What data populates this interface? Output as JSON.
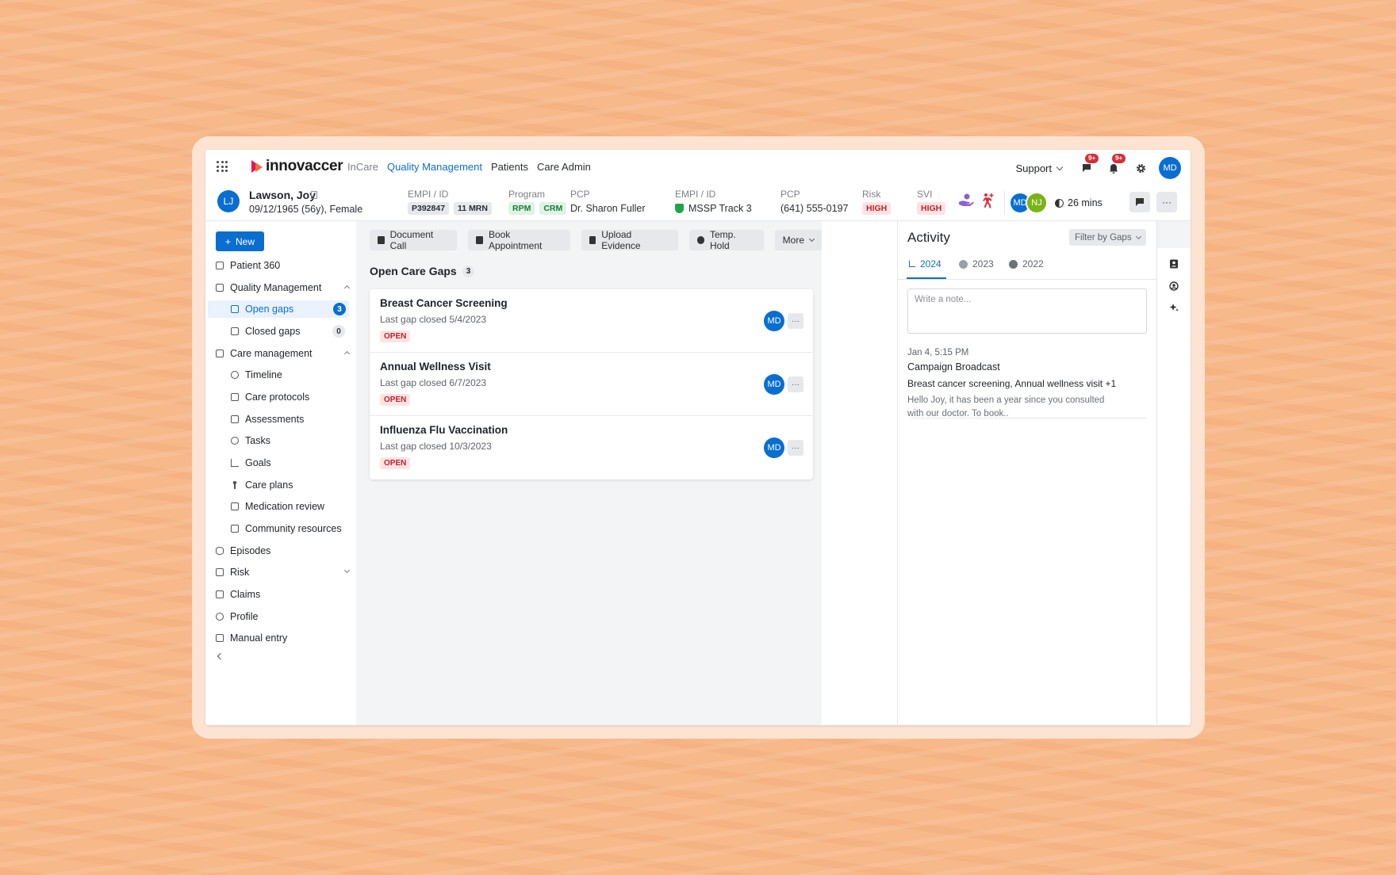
{
  "topnav": {
    "logo": "innovaccer",
    "links": [
      {
        "label": "InCare",
        "state": "muted"
      },
      {
        "label": "Quality Management",
        "state": "active"
      },
      {
        "label": "Patients",
        "state": "normal"
      },
      {
        "label": "Care Admin",
        "state": "normal"
      }
    ],
    "support_label": "Support",
    "messages_badge": "9+",
    "notifications_badge": "9+",
    "user_initials": "MD"
  },
  "patient": {
    "initials": "LJ",
    "name": "Lawson, Joy",
    "dob_line": "09/12/1965 (56y), Female",
    "empi_label": "EMPI / ID",
    "empi_ids": [
      "P392847",
      "11 MRN"
    ],
    "program_label": "Program",
    "programs": [
      "RPM",
      "CRM"
    ],
    "pcp_label": "PCP",
    "pcp_name": "Dr. Sharon Fuller",
    "empi2_label": "EMPI / ID",
    "plan": "MSSP Track 3",
    "pcp2_label": "PCP",
    "phone": "(641) 555-0197",
    "risk_label": "Risk",
    "risk_value": "HIGH",
    "svi_label": "SVI",
    "svi_value": "HIGH",
    "care_team": [
      "MD",
      "NJ"
    ],
    "timer": "26 mins",
    "more_label": "···"
  },
  "sidebar": {
    "new_label": "New",
    "items": [
      {
        "label": "Patient 360",
        "level": 0
      },
      {
        "label": "Quality Management",
        "level": 0,
        "expanded": true
      },
      {
        "label": "Open gaps",
        "level": 1,
        "active": true,
        "count": "3"
      },
      {
        "label": "Closed gaps",
        "level": 1,
        "count": "0"
      },
      {
        "label": "Care management",
        "level": 0,
        "expanded": true
      },
      {
        "label": "Timeline",
        "level": 1
      },
      {
        "label": "Care protocols",
        "level": 1
      },
      {
        "label": "Assessments",
        "level": 1
      },
      {
        "label": "Tasks",
        "level": 1
      },
      {
        "label": "Goals",
        "level": 1
      },
      {
        "label": "Care plans",
        "level": 1
      },
      {
        "label": "Medication review",
        "level": 1
      },
      {
        "label": "Community resources",
        "level": 1
      },
      {
        "label": "Episodes",
        "level": 0
      },
      {
        "label": "Risk",
        "level": 0,
        "expanded": false
      },
      {
        "label": "Claims",
        "level": 0
      },
      {
        "label": "Profile",
        "level": 0
      },
      {
        "label": "Manual entry",
        "level": 0
      }
    ]
  },
  "toolbar": {
    "buttons": [
      "Document Call",
      "Book Appointment",
      "Upload Evidence",
      "Temp. Hold",
      "More"
    ]
  },
  "gaps": {
    "title": "Open Care Gaps",
    "count": "3",
    "rows": [
      {
        "title": "Breast Cancer Screening",
        "subtitle": "Last gap closed 5/4/2023",
        "status": "OPEN",
        "assignee": "MD",
        "menu": "···"
      },
      {
        "title": "Annual Wellness Visit",
        "subtitle": "Last gap closed 6/7/2023",
        "status": "OPEN",
        "assignee": "MD",
        "menu": "···"
      },
      {
        "title": "Influenza Flu Vaccination",
        "subtitle": "Last gap closed 10/3/2023",
        "status": "OPEN",
        "assignee": "MD",
        "menu": "···"
      }
    ]
  },
  "activity": {
    "title": "Activity",
    "filter_label": "Filter by Gaps",
    "years": [
      "2024",
      "2023",
      "2022"
    ],
    "note_placeholder": "Write a note...",
    "entry": {
      "time": "Jan 4, 5:15 PM",
      "type": "Campaign Broadcast",
      "subject": "Breast cancer screening, Annual wellness visit +1",
      "body": "Hello Joy, it has been a year since you consulted with our doctor. To book.."
    }
  },
  "colors": {
    "accent": "#0a6ed1",
    "danger": "#d62f39",
    "success": "#20a44b",
    "background": "#f7b88a"
  }
}
